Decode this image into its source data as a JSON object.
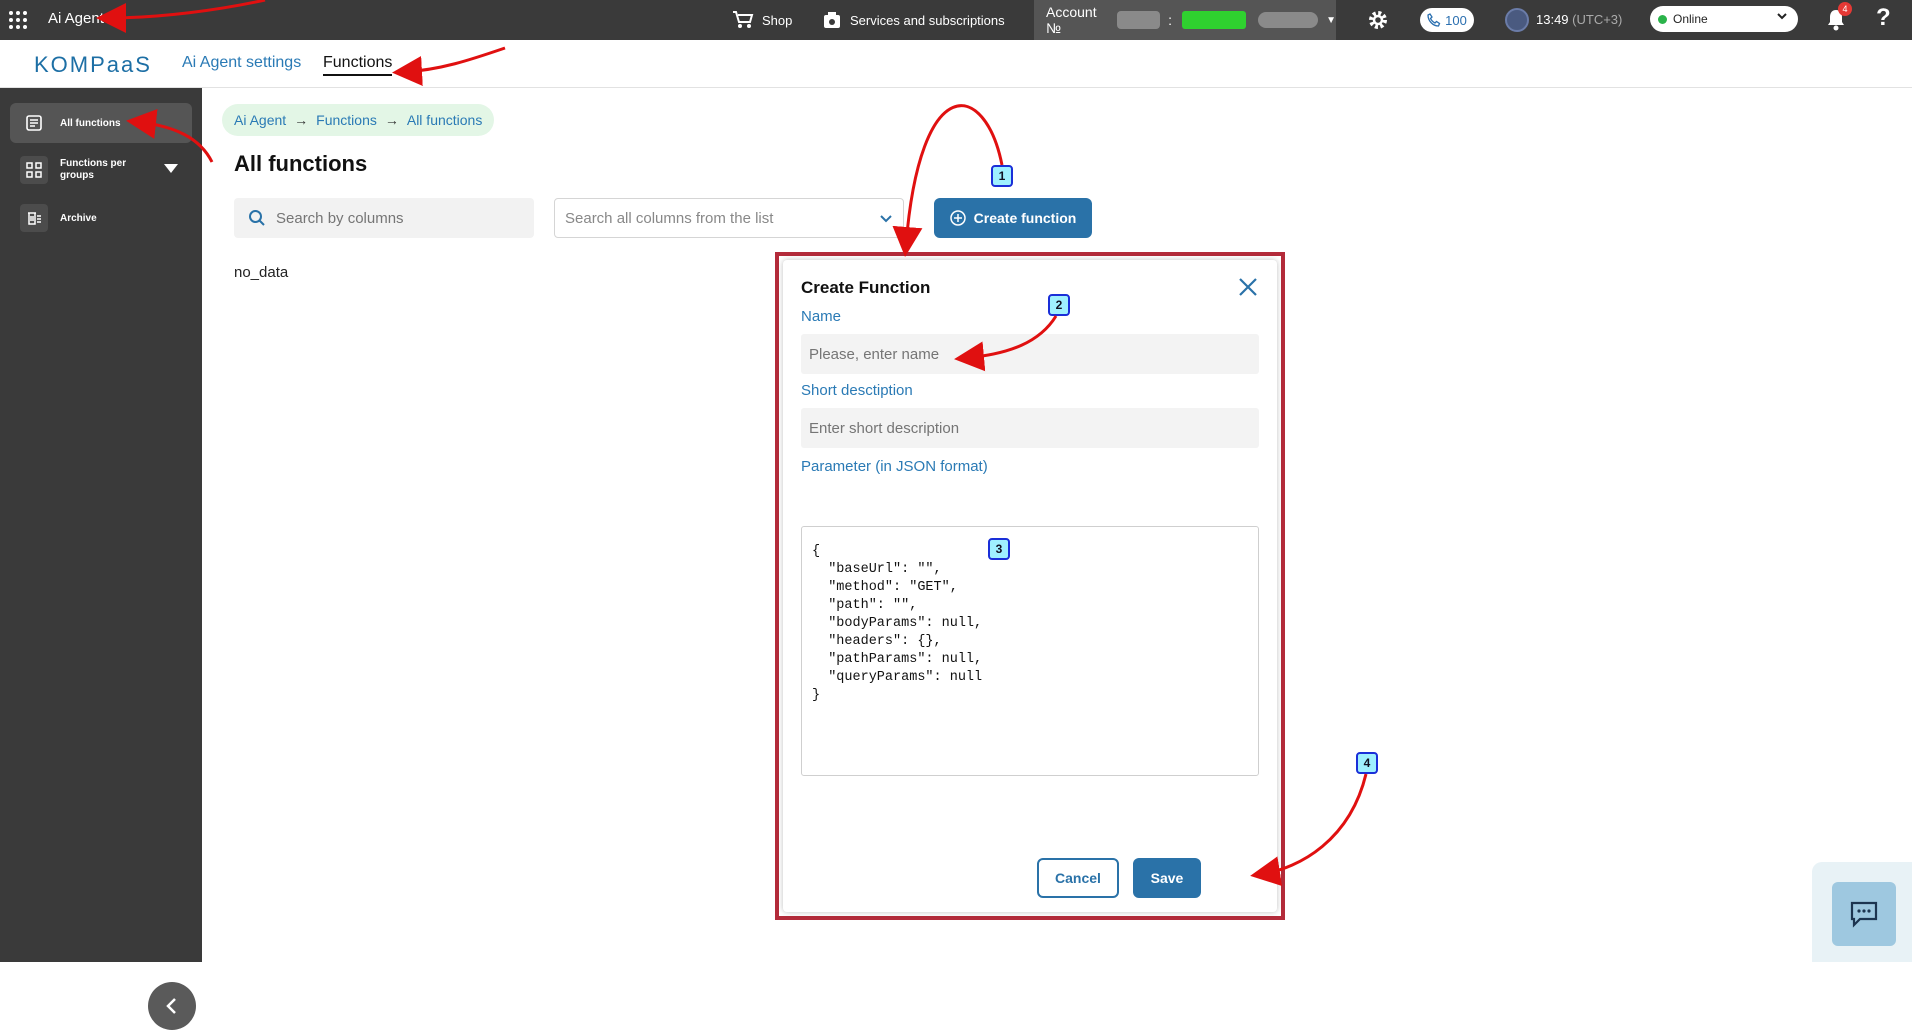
{
  "topbar": {
    "app_title": "Ai Agent",
    "shop_label": "Shop",
    "services_label": "Services and subscriptions",
    "account_label": "Account №",
    "account_separator": ":",
    "phone_count": "100",
    "time": "13:49",
    "timezone": "(UTC+3)",
    "status_value": "Online",
    "notification_count": "4",
    "help_label": "?"
  },
  "subnav": {
    "logo": "KOMPaaS",
    "tabs": [
      {
        "label": "Ai Agent settings"
      },
      {
        "label": "Functions"
      }
    ]
  },
  "sidebar": {
    "items": [
      {
        "label": "All functions"
      },
      {
        "label": "Functions per groups"
      },
      {
        "label": "Archive"
      }
    ]
  },
  "breadcrumb": {
    "items": [
      "Ai Agent",
      "Functions",
      "All functions"
    ],
    "separator": "→"
  },
  "main": {
    "title": "All functions",
    "search_placeholder": "Search by columns",
    "columns_select_placeholder": "Search all columns from the list",
    "create_button": "Create function",
    "empty_text": "no_data"
  },
  "modal": {
    "title": "Create Function",
    "name_label": "Name",
    "name_placeholder": "Please, enter name",
    "short_desc_label": "Short desctiption",
    "short_desc_placeholder": "Enter short description",
    "param_label": "Parameter (in JSON format)",
    "param_value": "{\n  \"baseUrl\": \"\",\n  \"method\": \"GET\",\n  \"path\": \"\",\n  \"bodyParams\": null,\n  \"headers\": {},\n  \"pathParams\": null,\n  \"queryParams\": null\n}",
    "cancel_button": "Cancel",
    "save_button": "Save"
  },
  "annotations": {
    "steps": [
      "1",
      "2",
      "3",
      "4"
    ],
    "arrow_color": "#e01010",
    "frame_color": "#b32b3a"
  },
  "colors": {
    "primary": "#2a72a8",
    "topbar": "#3a3a3a",
    "sidebar": "#3a3a3a",
    "status_online": "#2ab34a"
  }
}
